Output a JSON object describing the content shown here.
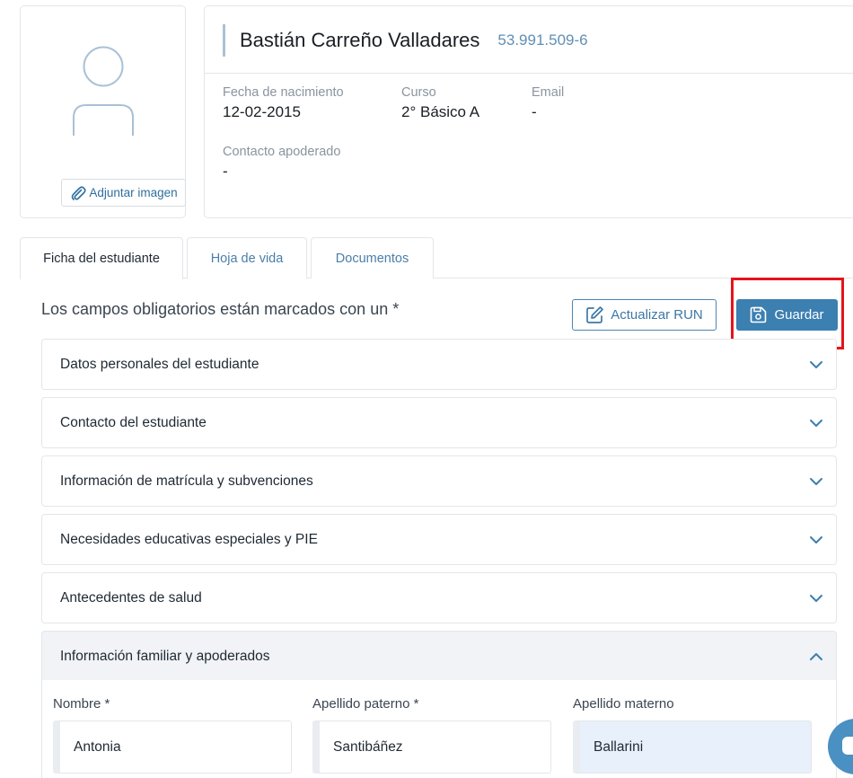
{
  "profile": {
    "attach_label": "Adjuntar imagen"
  },
  "student": {
    "name": "Bastián Carreño Valladares",
    "run": "53.991.509-6",
    "fields": [
      {
        "label": "Fecha de nacimiento",
        "value": "12-02-2015"
      },
      {
        "label": "Curso",
        "value": "2° Básico A"
      },
      {
        "label": "Email",
        "value": "-"
      },
      {
        "label": "Contacto apoderado",
        "value": "-"
      }
    ]
  },
  "tabs": [
    {
      "label": "Ficha del estudiante",
      "active": true
    },
    {
      "label": "Hoja de vida",
      "active": false
    },
    {
      "label": "Documentos",
      "active": false
    }
  ],
  "form": {
    "required_note": "Los campos obligatorios están marcados con un *",
    "update_run_label": "Actualizar RUN",
    "save_label": "Guardar"
  },
  "sections": [
    {
      "title": "Datos personales del estudiante",
      "expanded": false
    },
    {
      "title": "Contacto del estudiante",
      "expanded": false
    },
    {
      "title": "Información de matrícula y subvenciones",
      "expanded": false
    },
    {
      "title": "Necesidades educativas especiales y PIE",
      "expanded": false
    },
    {
      "title": "Antecedentes de salud",
      "expanded": false
    },
    {
      "title": "Información familiar y apoderados",
      "expanded": true
    }
  ],
  "family": {
    "fields": [
      {
        "label": "Nombre *",
        "value": "Antonia"
      },
      {
        "label": "Apellido paterno *",
        "value": "Santibáñez"
      },
      {
        "label": "Apellido materno",
        "value": "Ballarini"
      }
    ]
  },
  "colors": {
    "accent": "#3c7fb1",
    "highlight": "#e5131b",
    "link": "#4a7fa9"
  },
  "icons": [
    "user-placeholder-icon",
    "paperclip-icon",
    "edit-icon",
    "save-icon",
    "chevron-down-icon",
    "chevron-up-icon",
    "chat-icon"
  ]
}
